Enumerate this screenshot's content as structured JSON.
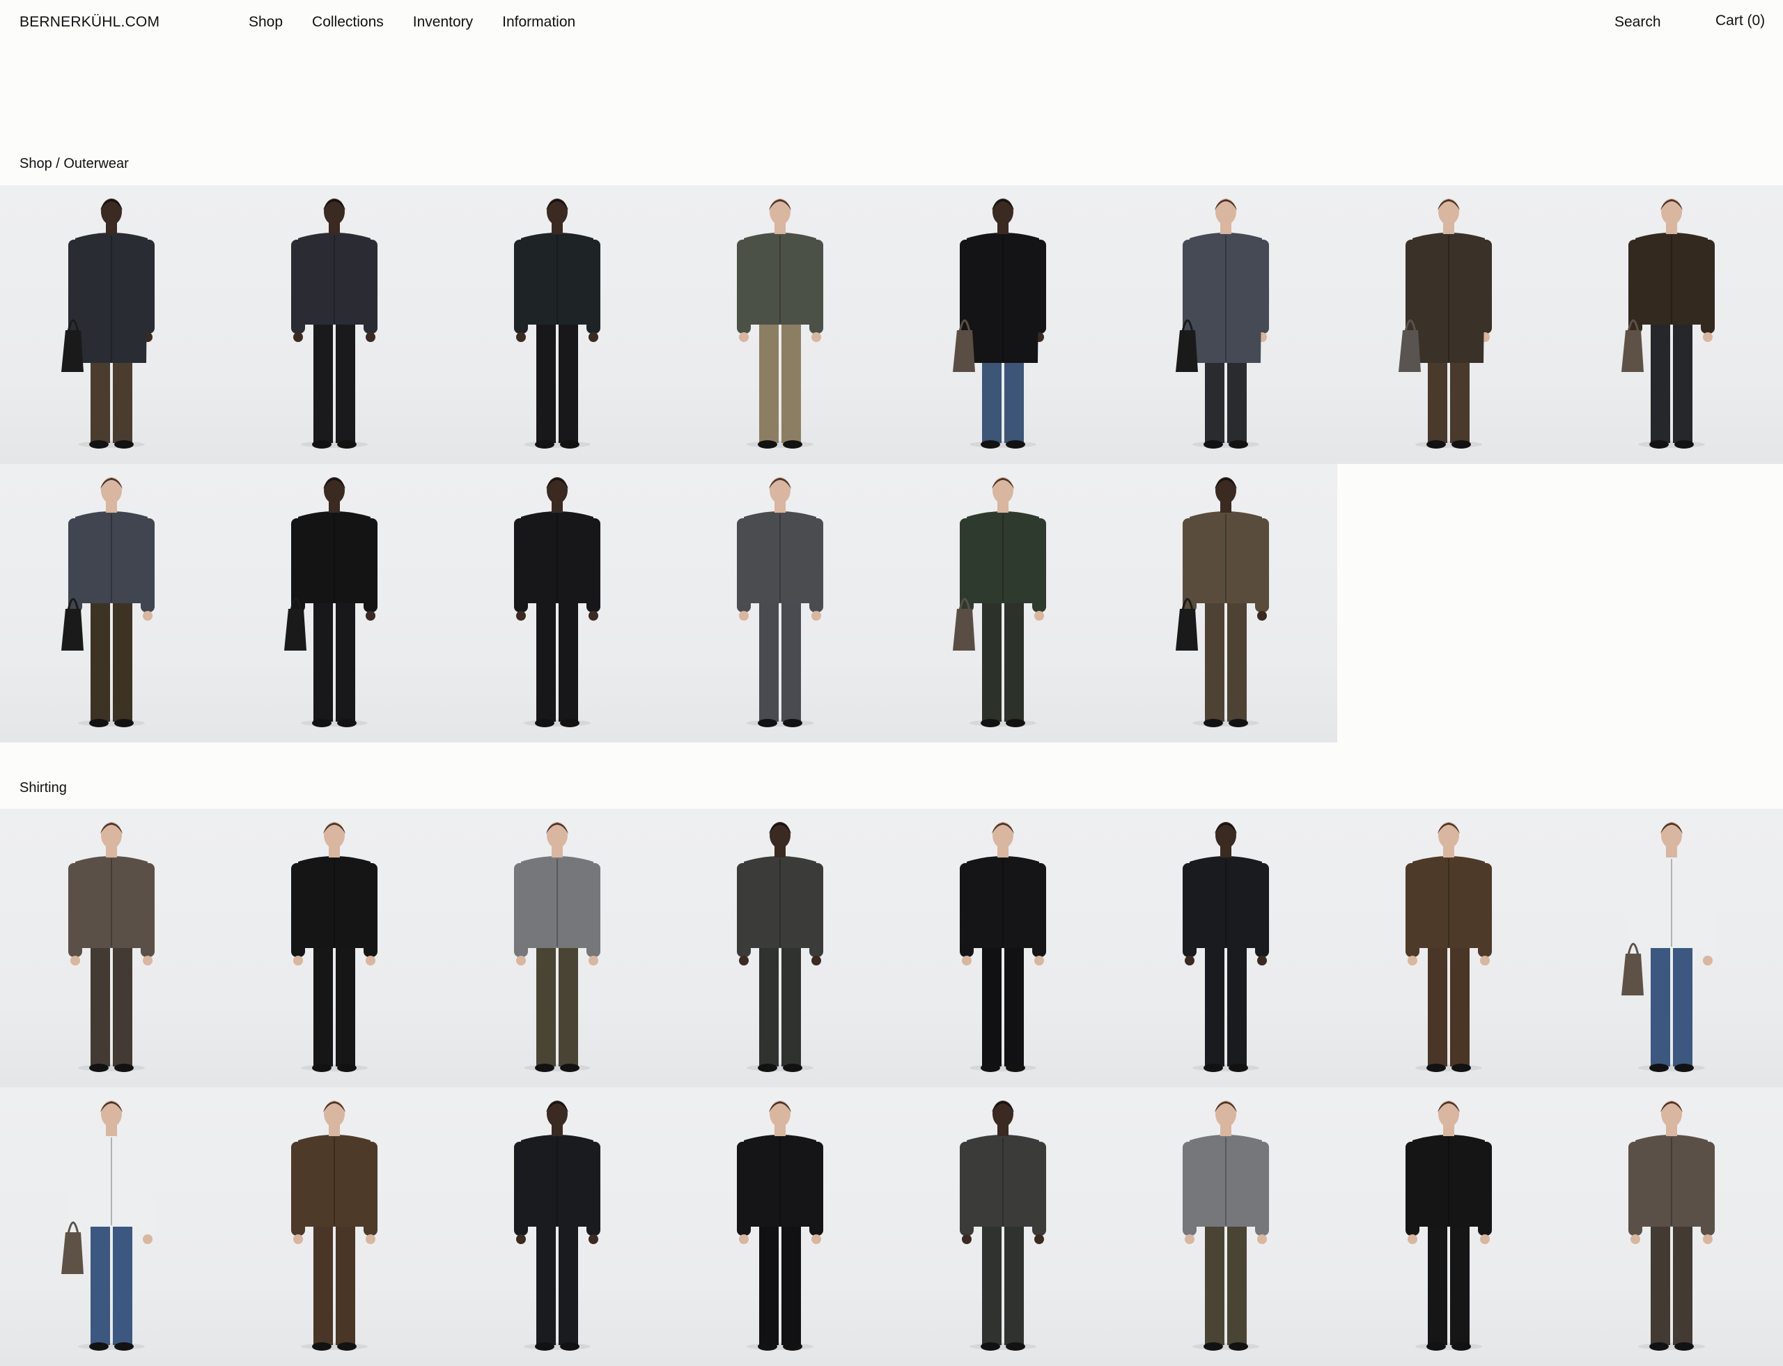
{
  "header": {
    "logo": "BERNERKÜHL.COM",
    "nav": [
      "Shop",
      "Collections",
      "Inventory",
      "Information"
    ],
    "search": "Search",
    "cart": "Cart (0)"
  },
  "sections": [
    {
      "title": "Shop / Outerwear",
      "products": [
        {
          "coat": "#2a2c33",
          "pants": "#4a3d30",
          "skin": "#3b2a22",
          "hair": "#161210",
          "long": true,
          "bag": "#1a1a1a"
        },
        {
          "coat": "#2b2c33",
          "pants": "#1a1a1c",
          "skin": "#3b2a22",
          "hair": "#161210",
          "long": false,
          "bag": ""
        },
        {
          "coat": "#1e2426",
          "pants": "#18181a",
          "skin": "#3b2a22",
          "hair": "#161210",
          "long": false,
          "bag": ""
        },
        {
          "coat": "#4c5148",
          "pants": "#8c7e62",
          "skin": "#d8b6a0",
          "hair": "#4a3226",
          "long": false,
          "bag": ""
        },
        {
          "coat": "#141416",
          "pants": "#3d5576",
          "skin": "#3b2a22",
          "hair": "#161210",
          "long": true,
          "bag": "#5a4e44"
        },
        {
          "coat": "#454a55",
          "pants": "#2a2b2e",
          "skin": "#d8b6a0",
          "hair": "#4a3226",
          "long": true,
          "bag": "#1a1a1a"
        },
        {
          "coat": "#3a3129",
          "pants": "#4a3a2c",
          "skin": "#d8b6a0",
          "hair": "#4a3226",
          "long": true,
          "bag": "#5a5450"
        },
        {
          "coat": "#33291f",
          "pants": "#26272a",
          "skin": "#d8b6a0",
          "hair": "#4a3226",
          "long": false,
          "bag": "#5e5247"
        }
      ]
    },
    {
      "title": "",
      "products": [
        {
          "coat": "#40454f",
          "pants": "#3d3324",
          "skin": "#d8b6a0",
          "hair": "#4a3226",
          "long": false,
          "bag": "#1a1a1a"
        },
        {
          "coat": "#141415",
          "pants": "#18181a",
          "skin": "#3b2a22",
          "hair": "#161210",
          "long": false,
          "bag": "#1a1a1a"
        },
        {
          "coat": "#17171a",
          "pants": "#17171a",
          "skin": "#3b2a22",
          "hair": "#161210",
          "long": false,
          "bag": ""
        },
        {
          "coat": "#4b4c50",
          "pants": "#4a4b50",
          "skin": "#d8b6a0",
          "hair": "#4a3226",
          "long": false,
          "bag": ""
        },
        {
          "coat": "#2f3a2f",
          "pants": "#2c312a",
          "skin": "#d8b6a0",
          "hair": "#4a3226",
          "long": false,
          "bag": "#5a4e44"
        },
        {
          "coat": "#5a4c3c",
          "pants": "#4d4234",
          "skin": "#3b2a22",
          "hair": "#161210",
          "long": false,
          "bag": "#1a1a1a"
        }
      ]
    },
    {
      "title": "Shirting",
      "products": [
        {
          "coat": "#5a5048",
          "pants": "#433a34",
          "skin": "#d8b6a0",
          "hair": "#4a3226",
          "long": false,
          "bag": ""
        },
        {
          "coat": "#151516",
          "pants": "#161617",
          "skin": "#d8b6a0",
          "hair": "#4a3226",
          "long": false,
          "bag": ""
        },
        {
          "coat": "#76777b",
          "pants": "#4a4434",
          "skin": "#d8b6a0",
          "hair": "#4a3226",
          "long": false,
          "bag": ""
        },
        {
          "coat": "#3b3c3a",
          "pants": "#2f322e",
          "skin": "#3b2a22",
          "hair": "#161210",
          "long": false,
          "bag": ""
        },
        {
          "coat": "#151517",
          "pants": "#111114",
          "skin": "#d8b6a0",
          "hair": "#4a3226",
          "long": false,
          "bag": ""
        },
        {
          "coat": "#1a1b1e",
          "pants": "#1a1b1e",
          "skin": "#3b2a22",
          "hair": "#161210",
          "long": false,
          "bag": ""
        },
        {
          "coat": "#4e3a28",
          "pants": "#4a3626",
          "skin": "#d8b6a0",
          "hair": "#4a3226",
          "long": false,
          "bag": ""
        },
        {
          "coat": "#eceef0",
          "pants": "#3c5880",
          "skin": "#d8b6a0",
          "hair": "#4a3226",
          "long": false,
          "bag": "#5e5247"
        }
      ]
    }
  ]
}
